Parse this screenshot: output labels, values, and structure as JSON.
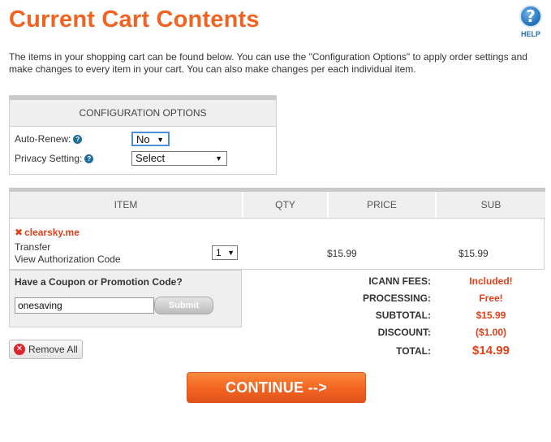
{
  "page": {
    "title": "Current Cart Contents",
    "help_label": "HELP",
    "help_glyph": "?",
    "intro": "The items in your shopping cart can be found below. You can use the \"Configuration Options\" to apply order settings and make changes to every item in your cart. You can also make changes per each individual item."
  },
  "config": {
    "header": "CONFIGURATION OPTIONS",
    "auto_renew_label": "Auto-Renew:",
    "auto_renew_value": "No",
    "privacy_label": "Privacy Setting:",
    "privacy_value": "Select",
    "info_glyph": "?"
  },
  "cart": {
    "columns": [
      "ITEM",
      "QTY",
      "PRICE",
      "SUB"
    ],
    "items": [
      {
        "domain": "clearsky.me",
        "remove_glyph": "✖",
        "type": "Transfer",
        "link": "View Authorization Code",
        "qty": "1",
        "price": "$15.99",
        "sub": "$15.99"
      }
    ]
  },
  "coupon": {
    "title": "Have a Coupon or Promotion Code?",
    "value": "onesaving",
    "submit_label": "Submit"
  },
  "totals": {
    "icann_label": "ICANN FEES:",
    "icann_value": "Included!",
    "processing_label": "PROCESSING:",
    "processing_value": "Free!",
    "subtotal_label": "SUBTOTAL:",
    "subtotal_value": "$15.99",
    "discount_label": "DISCOUNT:",
    "discount_value": "($1.00)",
    "total_label": "TOTAL:",
    "total_value": "$14.99"
  },
  "actions": {
    "remove_all_label": "Remove All",
    "remove_glyph": "✕",
    "continue_label": "CONTINUE -->"
  },
  "colors": {
    "accent_orange": "#f26322",
    "alert_red": "#e0401b",
    "help_blue": "#1f6fb8"
  }
}
